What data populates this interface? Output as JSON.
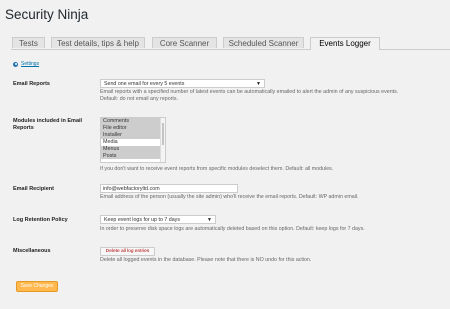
{
  "app": {
    "title": "Security Ninja"
  },
  "tabs": [
    {
      "label": "Tests"
    },
    {
      "label": "Test details, tips & help"
    },
    {
      "label": "Core Scanner"
    },
    {
      "label": "Scheduled Scanner"
    },
    {
      "label": "Events Logger",
      "active": true
    }
  ],
  "settings_link": {
    "label": "Settings"
  },
  "email_reports": {
    "label": "Email Reports",
    "selected": "Send one email for every 5 events",
    "description_line1": "Email reports with a specified number of latest events can be automatically emailed to alert the admin of any suspicious events.",
    "description_line2": "Default: do not email any reports."
  },
  "modules": {
    "label_line1": "Modules included in Email",
    "label_line2": "Reports",
    "options": [
      {
        "label": "Comments",
        "selected": true
      },
      {
        "label": "File editor",
        "selected": true
      },
      {
        "label": "Installer",
        "selected": true
      },
      {
        "label": "Media",
        "selected": false
      },
      {
        "label": "Menus",
        "selected": true
      },
      {
        "label": "Posts",
        "selected": true
      }
    ],
    "description": "If you don't want to receive event reports from specific modules deselect them. Default: all modules."
  },
  "email_recipient": {
    "label": "Email Recipient",
    "value": "info@webfactoryltd.com",
    "description": "Email address of the person (usually the site admin) who'll receive the email reports. Default: WP admin email."
  },
  "log_retention": {
    "label": "Log Retention Policy",
    "selected": "Keep event logs for up to 7 days",
    "description": "In order to preserve disk space logs are automatically deleted based on this option. Default: keep logs for 7 days."
  },
  "misc": {
    "label": "Miscellaneous",
    "button_label": "Delete all log entries",
    "description": "Delete all logged events in the database. Please note that there is NO undo for this action."
  },
  "save_button": {
    "label": "Save Changes"
  },
  "colors": {
    "link": "#0073aa",
    "primary_button": "#ffb84d"
  }
}
